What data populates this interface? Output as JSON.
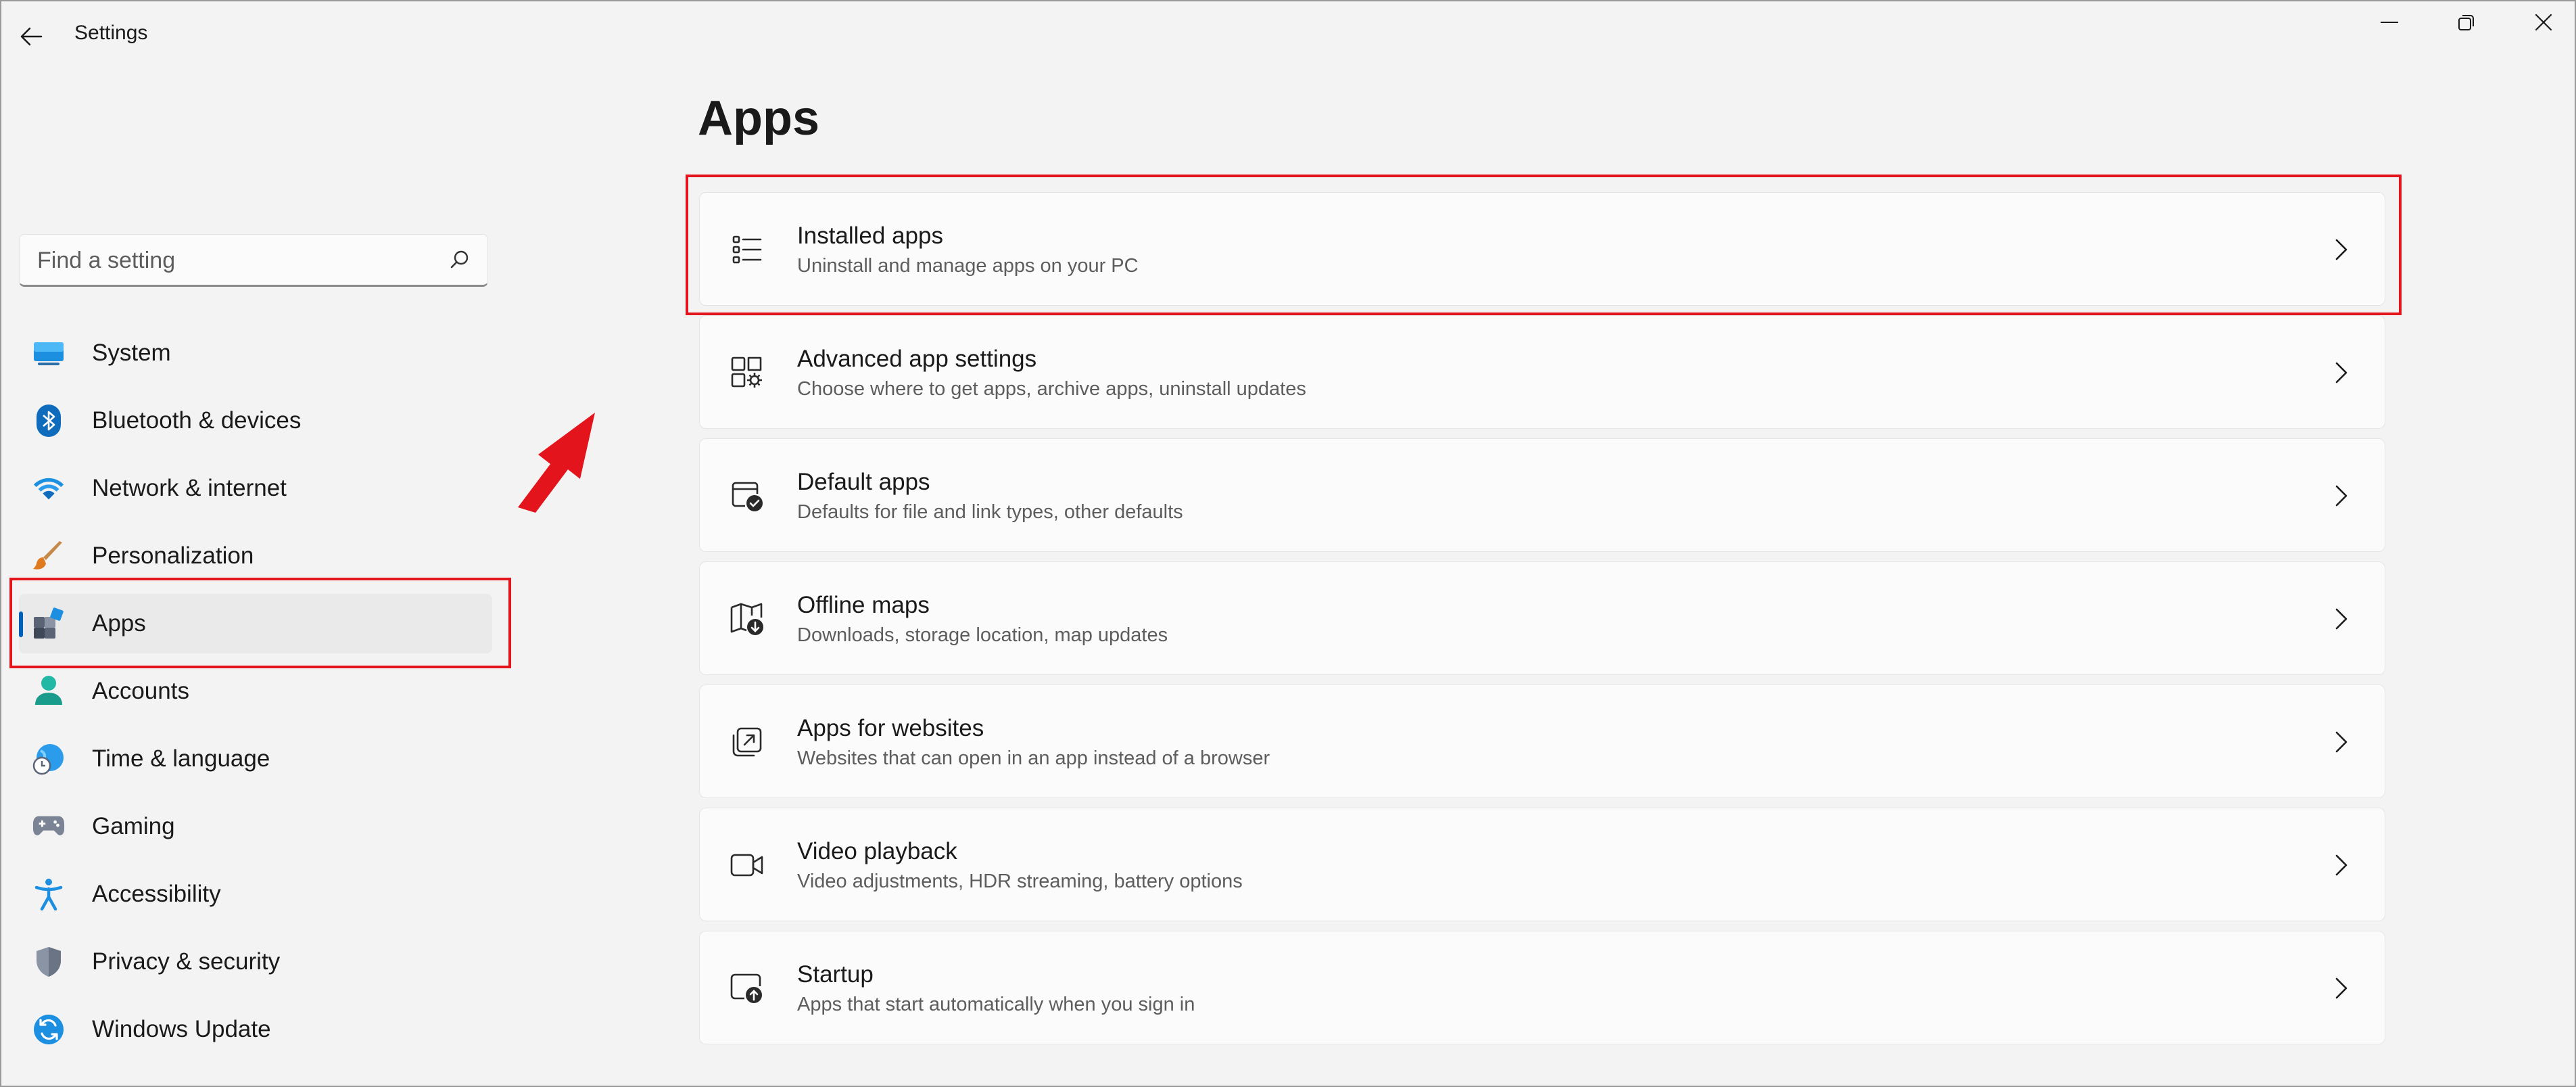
{
  "window": {
    "title": "Settings",
    "minimize_icon": "minimize-icon",
    "maximize_icon": "restore-icon",
    "close_icon": "close-icon"
  },
  "search": {
    "placeholder": "Find a setting",
    "value": ""
  },
  "sidebar": {
    "items": [
      {
        "label": "System",
        "icon": "system-icon"
      },
      {
        "label": "Bluetooth & devices",
        "icon": "bluetooth-icon"
      },
      {
        "label": "Network & internet",
        "icon": "wifi-icon"
      },
      {
        "label": "Personalization",
        "icon": "brush-icon"
      },
      {
        "label": "Apps",
        "icon": "apps-icon",
        "selected": true
      },
      {
        "label": "Accounts",
        "icon": "person-icon"
      },
      {
        "label": "Time & language",
        "icon": "globe-clock-icon"
      },
      {
        "label": "Gaming",
        "icon": "gamepad-icon"
      },
      {
        "label": "Accessibility",
        "icon": "accessibility-icon"
      },
      {
        "label": "Privacy & security",
        "icon": "shield-icon"
      },
      {
        "label": "Windows Update",
        "icon": "update-icon"
      }
    ]
  },
  "main": {
    "title": "Apps",
    "cards": [
      {
        "title": "Installed apps",
        "subtitle": "Uninstall and manage apps on your PC",
        "icon": "list-icon"
      },
      {
        "title": "Advanced app settings",
        "subtitle": "Choose where to get apps, archive apps, uninstall updates",
        "icon": "app-settings-icon"
      },
      {
        "title": "Default apps",
        "subtitle": "Defaults for file and link types, other defaults",
        "icon": "default-apps-icon"
      },
      {
        "title": "Offline maps",
        "subtitle": "Downloads, storage location, map updates",
        "icon": "map-download-icon"
      },
      {
        "title": "Apps for websites",
        "subtitle": "Websites that can open in an app instead of a browser",
        "icon": "open-in-app-icon"
      },
      {
        "title": "Video playback",
        "subtitle": "Video adjustments, HDR streaming, battery options",
        "icon": "video-icon"
      },
      {
        "title": "Startup",
        "subtitle": "Apps that start automatically when you sign in",
        "icon": "startup-icon"
      }
    ]
  },
  "colors": {
    "accent": "#005fb8",
    "annotation": "#e3141c"
  }
}
